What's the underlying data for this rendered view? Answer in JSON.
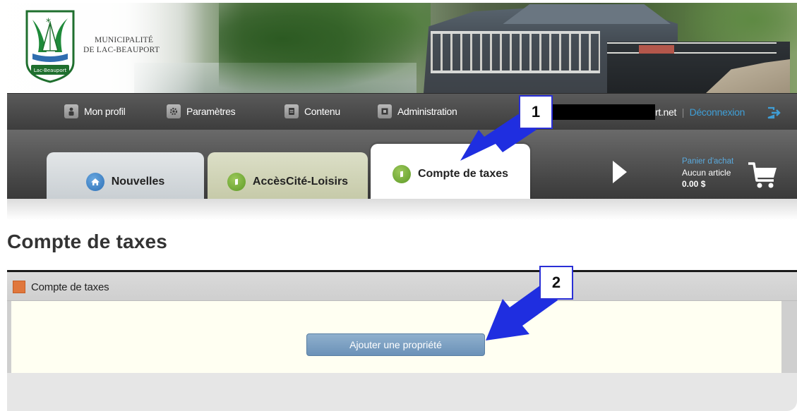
{
  "banner": {
    "logo_line1": "MUNICIPALITÉ",
    "logo_line2": "DE LAC-BEAUPORT",
    "logo_badge": "Lac-Beauport"
  },
  "toolbar": {
    "items": [
      {
        "label": "Mon profil",
        "icon": "person-icon"
      },
      {
        "label": "Paramètres",
        "icon": "gear-icon"
      },
      {
        "label": "Contenu",
        "icon": "document-icon"
      },
      {
        "label": "Administration",
        "icon": "admin-icon"
      }
    ],
    "account_suffix": "rt.net",
    "separator": "|",
    "logout_label": "Déconnexion"
  },
  "tabs": [
    {
      "label": "Nouvelles",
      "icon": "home-icon"
    },
    {
      "label": "AccèsCité-Loisirs",
      "icon": "leaf-icon"
    },
    {
      "label": "Compte de taxes",
      "icon": "leaf-icon",
      "active": true
    }
  ],
  "cart": {
    "label": "Panier d'achat",
    "items": "Aucun article",
    "total": "0.00 $"
  },
  "main": {
    "page_title": "Compte de taxes",
    "panel_title": "Compte de taxes",
    "add_button": "Ajouter une propriété"
  },
  "annotations": [
    {
      "label": "1"
    },
    {
      "label": "2"
    }
  ],
  "colors": {
    "callout_border": "#2a2fd6",
    "arrow": "#1f2ee0",
    "button": "#7a9ec2",
    "panel_swatch": "#e0773c",
    "link_blue": "#3f9ed6"
  }
}
